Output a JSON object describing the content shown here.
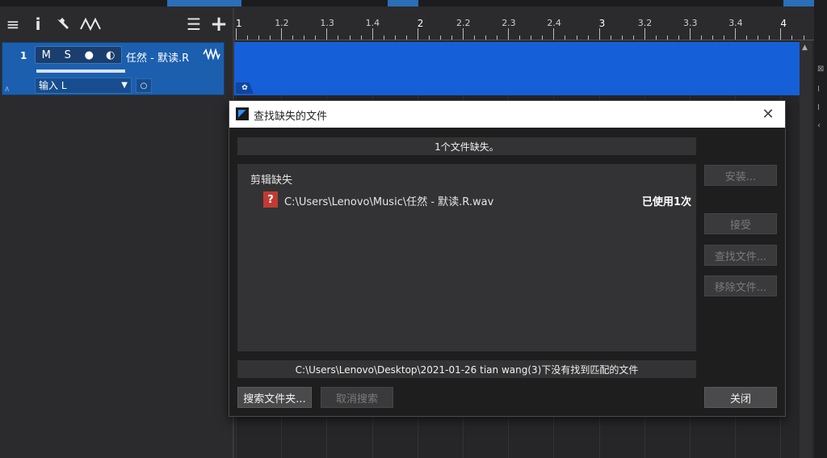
{
  "colors": {
    "track_blue": "#1c5fae",
    "clip_blue": "#1560d8",
    "dialog_bg": "#1e1e1f",
    "panel_bg": "#333335",
    "missing_icon": "#c23a33"
  },
  "toolbar": {
    "icons": [
      "menu-icon",
      "info-icon",
      "wrench-icon",
      "automation-curve-icon",
      "list-icon",
      "add-icon"
    ]
  },
  "track": {
    "number": "1",
    "mute": "M",
    "solo": "S",
    "name": "任然 - 默读.R",
    "input": "输入 L"
  },
  "ruler": {
    "labels": [
      "1",
      "1.2",
      "1.3",
      "1.4",
      "2",
      "2.2",
      "2.3",
      "2.4",
      "3",
      "3.2",
      "3.3",
      "3.4",
      "4"
    ]
  },
  "dialog": {
    "title": "查找缺失的文件",
    "missing_count": "1个文件缺失。",
    "section_title": "剪辑缺失",
    "files": [
      {
        "path": "C:\\Users\\Lenovo\\Music\\任然 - 默读.R.wav",
        "used": "已使用1次"
      }
    ],
    "status": "C:\\Users\\Lenovo\\Desktop\\2021-01-26 tian wang(3)下没有找到匹配的文件",
    "buttons": {
      "install": "安装...",
      "accept": "接受",
      "find_file": "查找文件...",
      "remove_file": "移除文件...",
      "search_folder": "搜索文件夹...",
      "cancel_search": "取消搜索",
      "close": "关闭"
    }
  }
}
